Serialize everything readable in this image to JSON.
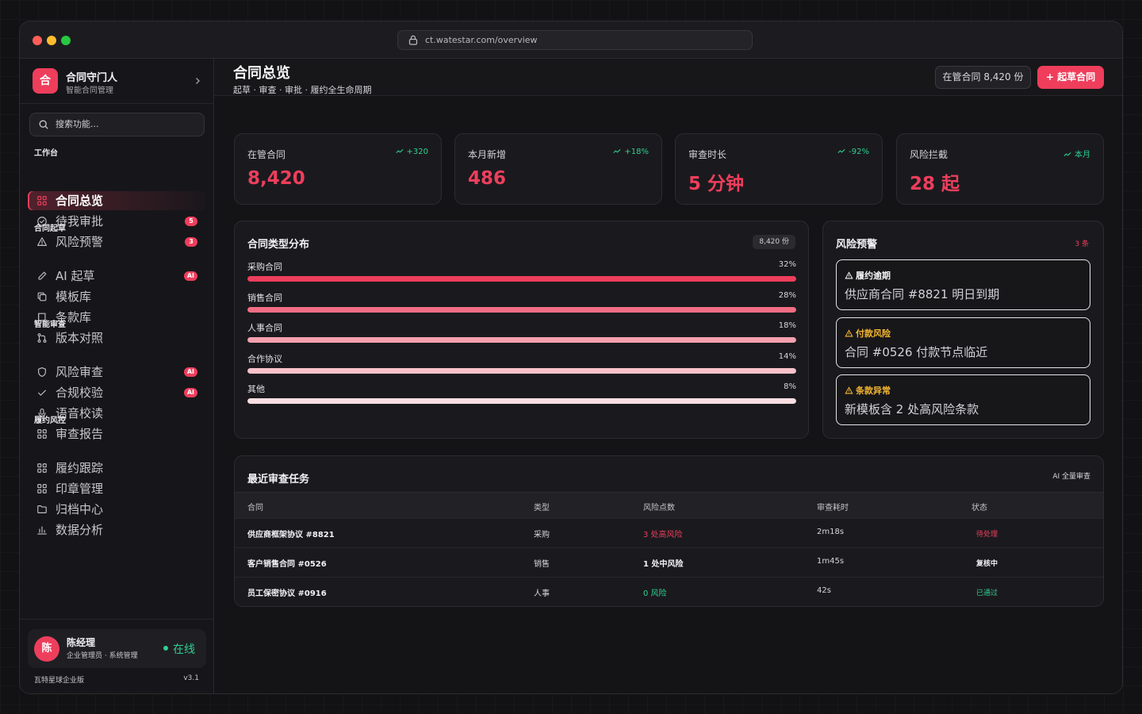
{
  "browser": {
    "url": "ct.watestar.com/overview"
  },
  "brand": {
    "logo": "合",
    "name": "合同守门人",
    "subtitle": "智能合同管理"
  },
  "search": {
    "placeholder": "搜索功能..."
  },
  "nav": {
    "groups": [
      "工作台",
      "合同起草",
      "智能审查",
      "履约风控"
    ],
    "items": [
      {
        "label": "合同总览",
        "icon": "grid-icon",
        "active": true
      },
      {
        "label": "待我审批",
        "icon": "check-circle-icon",
        "badge": "5"
      },
      {
        "label": "风险预警",
        "icon": "warning-icon",
        "badge": "3"
      },
      {
        "label": "AI 起草",
        "icon": "pen-icon",
        "badge": "AI"
      },
      {
        "label": "模板库",
        "icon": "copy-icon"
      },
      {
        "label": "条款库",
        "icon": "book-icon"
      },
      {
        "label": "版本对照",
        "icon": "git-compare-icon"
      },
      {
        "label": "风险审查",
        "icon": "shield-icon",
        "badge": "AI"
      },
      {
        "label": "合规校验",
        "icon": "check-icon",
        "badge": "AI"
      },
      {
        "label": "语音校读",
        "icon": "microphone-icon"
      },
      {
        "label": "审查报告",
        "icon": "grid-icon"
      },
      {
        "label": "履约跟踪",
        "icon": "grid-icon"
      },
      {
        "label": "印章管理",
        "icon": "grid-icon"
      },
      {
        "label": "归档中心",
        "icon": "folder-icon"
      },
      {
        "label": "数据分析",
        "icon": "bar-chart-icon"
      }
    ]
  },
  "user": {
    "avatar": "陈",
    "name": "陈经理",
    "role": "企业管理员 · 系统管理",
    "status": "在线"
  },
  "footer": {
    "edition": "瓦特星球企业版",
    "version": "v3.1"
  },
  "header": {
    "title": "合同总览",
    "subtitle": "起草 · 审查 · 审批 · 履约全生命周期",
    "count_chip": "在管合同 8,420 份",
    "primary_button": "+ 起草合同"
  },
  "kpis": [
    {
      "label": "在管合同",
      "value": "8,420",
      "trend": "+320"
    },
    {
      "label": "本月新增",
      "value": "486",
      "trend": "+18%"
    },
    {
      "label": "审查时长",
      "value": "5 分钟",
      "trend": "-92%"
    },
    {
      "label": "风险拦截",
      "value": "28 起",
      "trend": "本月"
    }
  ],
  "distribution": {
    "title": "合同类型分布",
    "total_tag": "8,420 份",
    "rows": [
      {
        "name": "采购合同",
        "pct_label": "32%",
        "fill": 1.0,
        "color": "#ee3e5c"
      },
      {
        "name": "销售合同",
        "pct_label": "28%",
        "fill": 1.0,
        "color": "#f16d83"
      },
      {
        "name": "人事合同",
        "pct_label": "18%",
        "fill": 1.0,
        "color": "#f5a0ae"
      },
      {
        "name": "合作协议",
        "pct_label": "14%",
        "fill": 1.0,
        "color": "#f8c2ca"
      },
      {
        "name": "其他",
        "pct_label": "8%",
        "fill": 1.0,
        "color": "#fbdfe3"
      }
    ]
  },
  "alerts": {
    "title": "风险预警",
    "count": "3 条",
    "items": [
      {
        "head": "履约逾期",
        "text": "供应商合同 #8821 明日到期",
        "color": "#f2f2f4"
      },
      {
        "head": "付款风险",
        "text": "合同 #0526 付款节点临近",
        "color": "#f5b731"
      },
      {
        "head": "条款异常",
        "text": "新模板含 2 处高风险条款",
        "color": "#f5b731"
      }
    ]
  },
  "tasks": {
    "title": "最近审查任务",
    "tag": "AI 全量审查",
    "columns": [
      "合同",
      "类型",
      "风险点数",
      "审查耗时",
      "状态"
    ],
    "rows": [
      {
        "name": "供应商框架协议 #8821",
        "type": "采购",
        "risk": "3 处高风险",
        "risk_color": "#ee3e5c",
        "time": "2m18s",
        "status": "待处理",
        "status_color": "#ee3e5c"
      },
      {
        "name": "客户销售合同 #0526",
        "type": "销售",
        "risk": "1 处中风险",
        "risk_color": "#f2f2f4",
        "time": "1m45s",
        "status": "复核中",
        "status_color": "#f2f2f4"
      },
      {
        "name": "员工保密协议 #0916",
        "type": "人事",
        "risk": "0 风险",
        "risk_color": "#2fcf8e",
        "time": "42s",
        "status": "已通过",
        "status_color": "#2fcf8e"
      }
    ]
  }
}
